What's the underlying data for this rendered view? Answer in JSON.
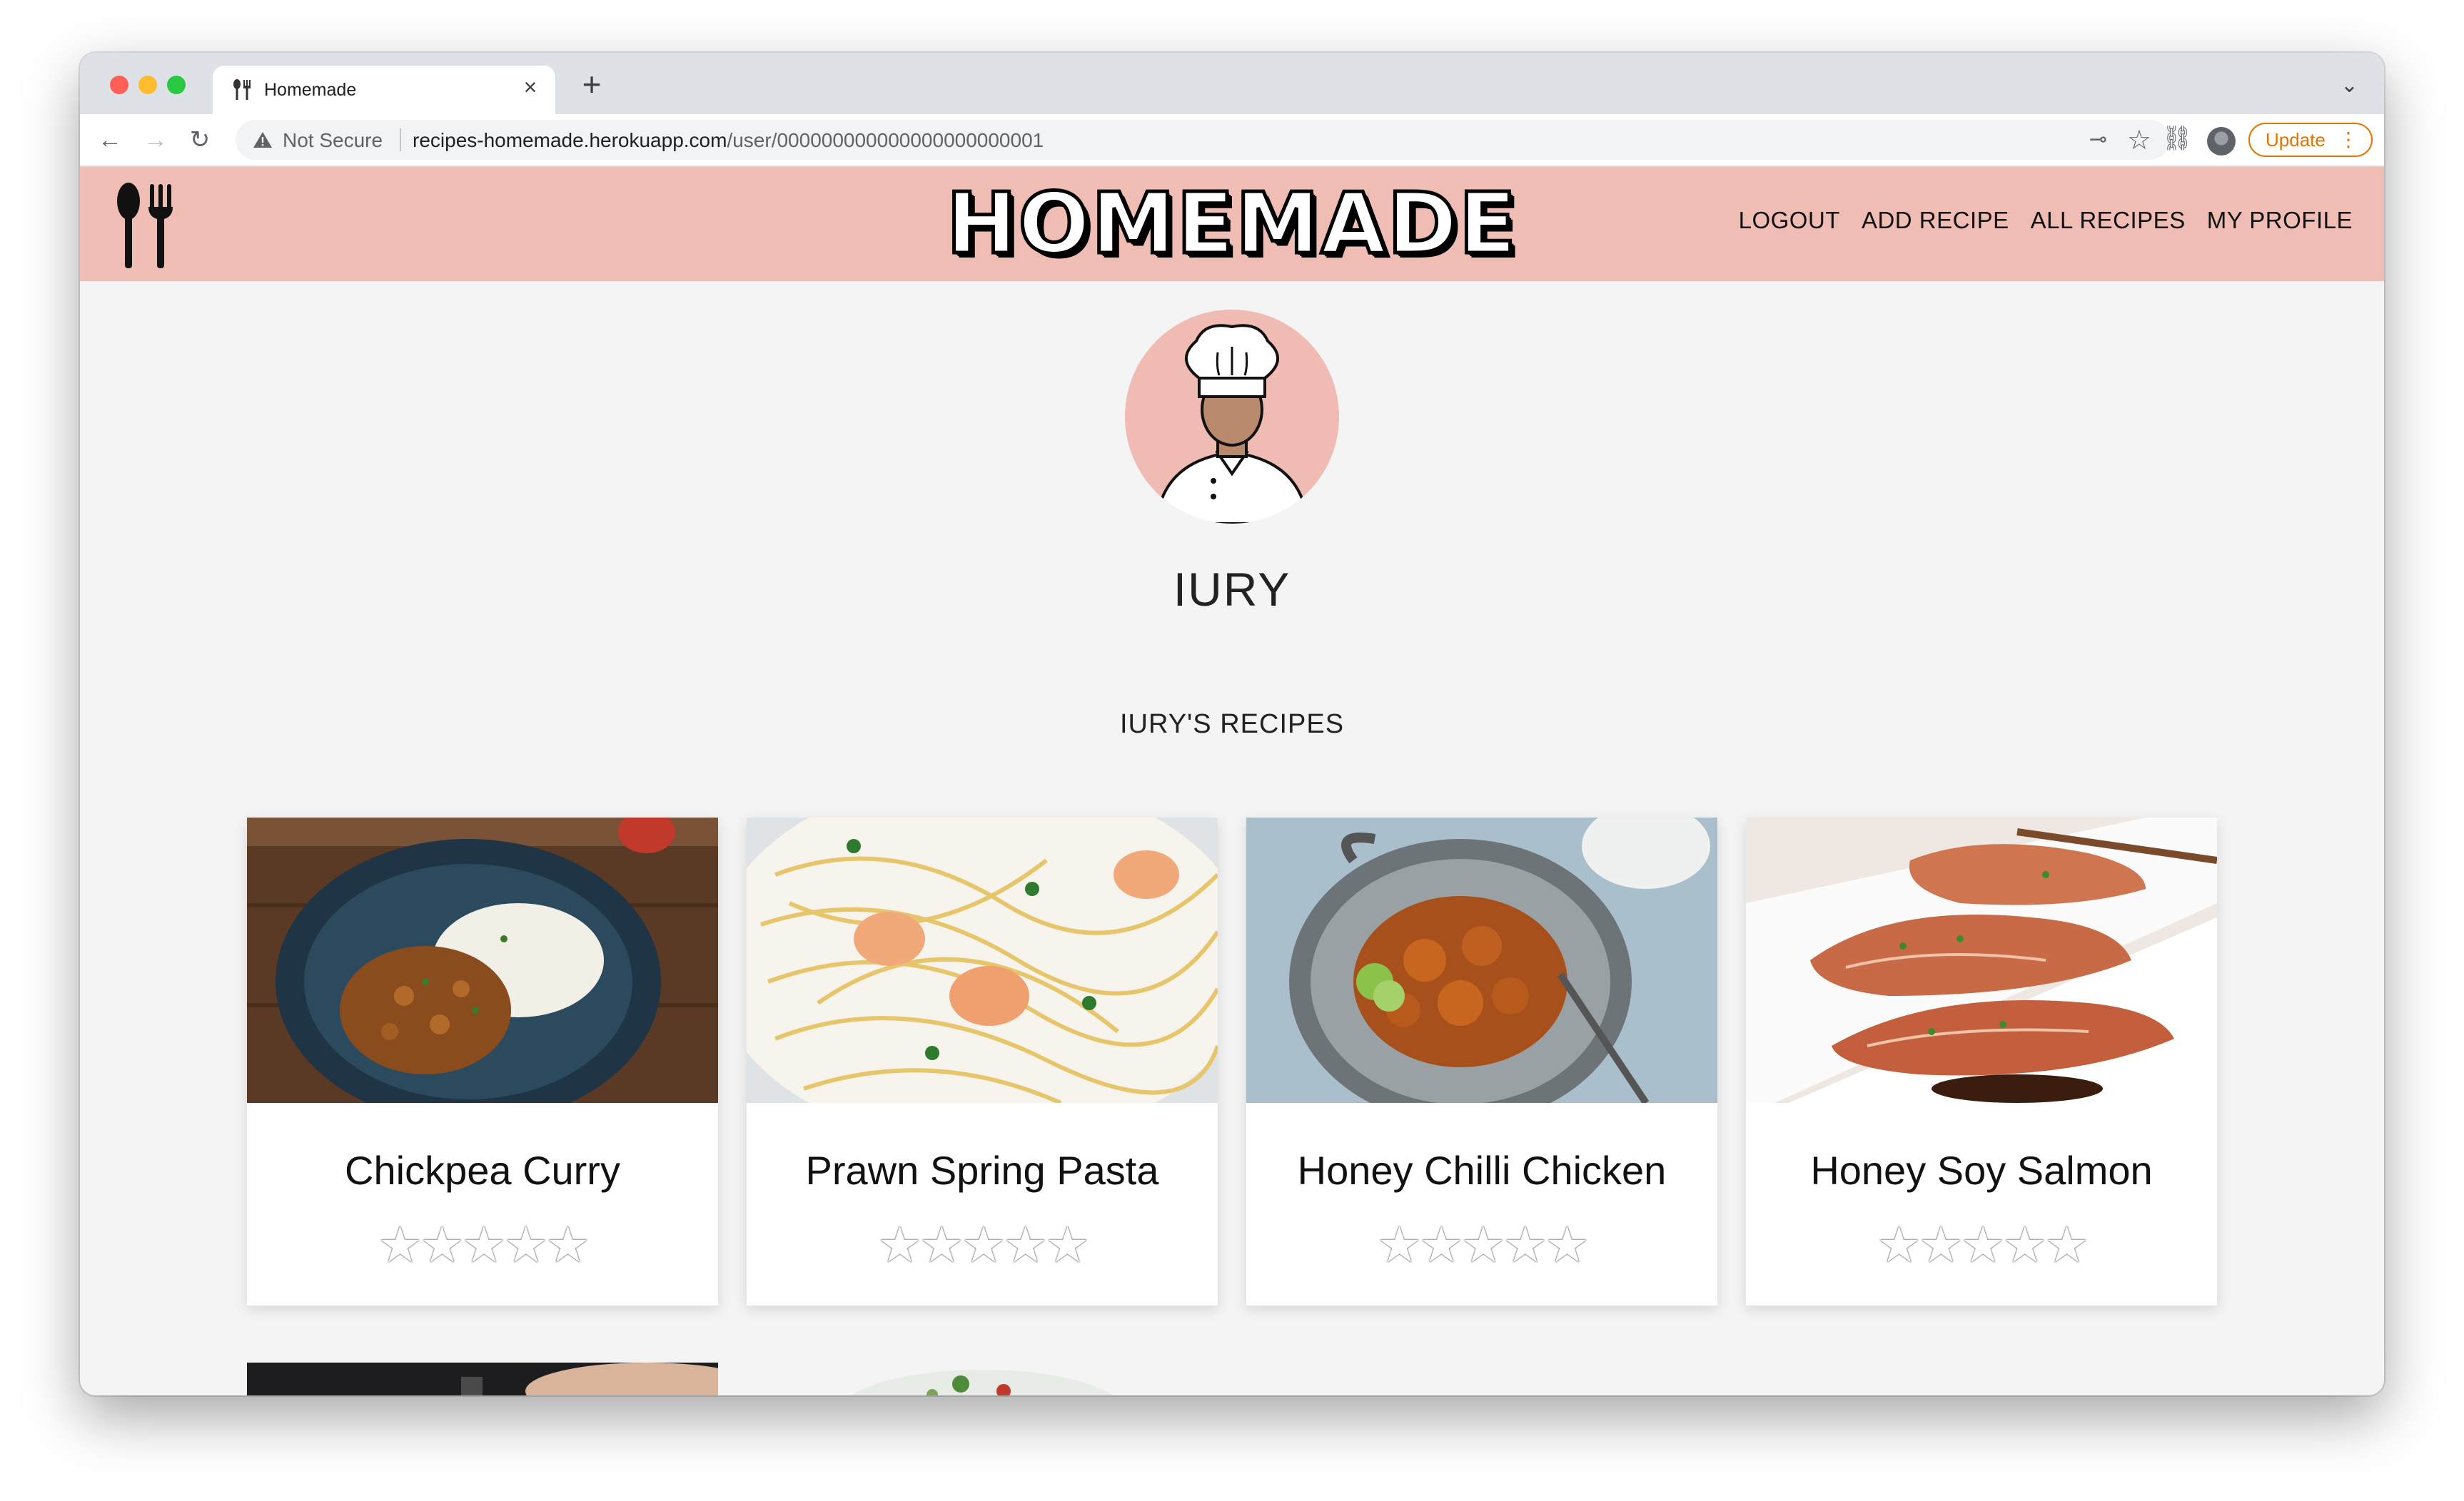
{
  "browser": {
    "tab_title": "Homemade",
    "new_tab": "+",
    "close": "×",
    "not_secure": "Not Secure",
    "url_host": "recipes-homemade.herokuapp.com",
    "url_path": "/user/000000000000000000000001",
    "update_label": "Update"
  },
  "site": {
    "brand": "HOMEMADE",
    "nav": [
      "LOGOUT",
      "ADD RECIPE",
      "ALL RECIPES",
      "MY PROFILE"
    ],
    "header_color": "#f0bdb4"
  },
  "profile": {
    "username": "IURY",
    "recipes_heading": "IURY'S RECIPES"
  },
  "recipes": [
    {
      "title": "Chickpea Curry",
      "rating": 0,
      "max_rating": 5
    },
    {
      "title": "Prawn Spring Pasta",
      "rating": 0,
      "max_rating": 5
    },
    {
      "title": "Honey Chilli Chicken",
      "rating": 0,
      "max_rating": 5
    },
    {
      "title": "Honey Soy Salmon",
      "rating": 0,
      "max_rating": 5
    }
  ]
}
